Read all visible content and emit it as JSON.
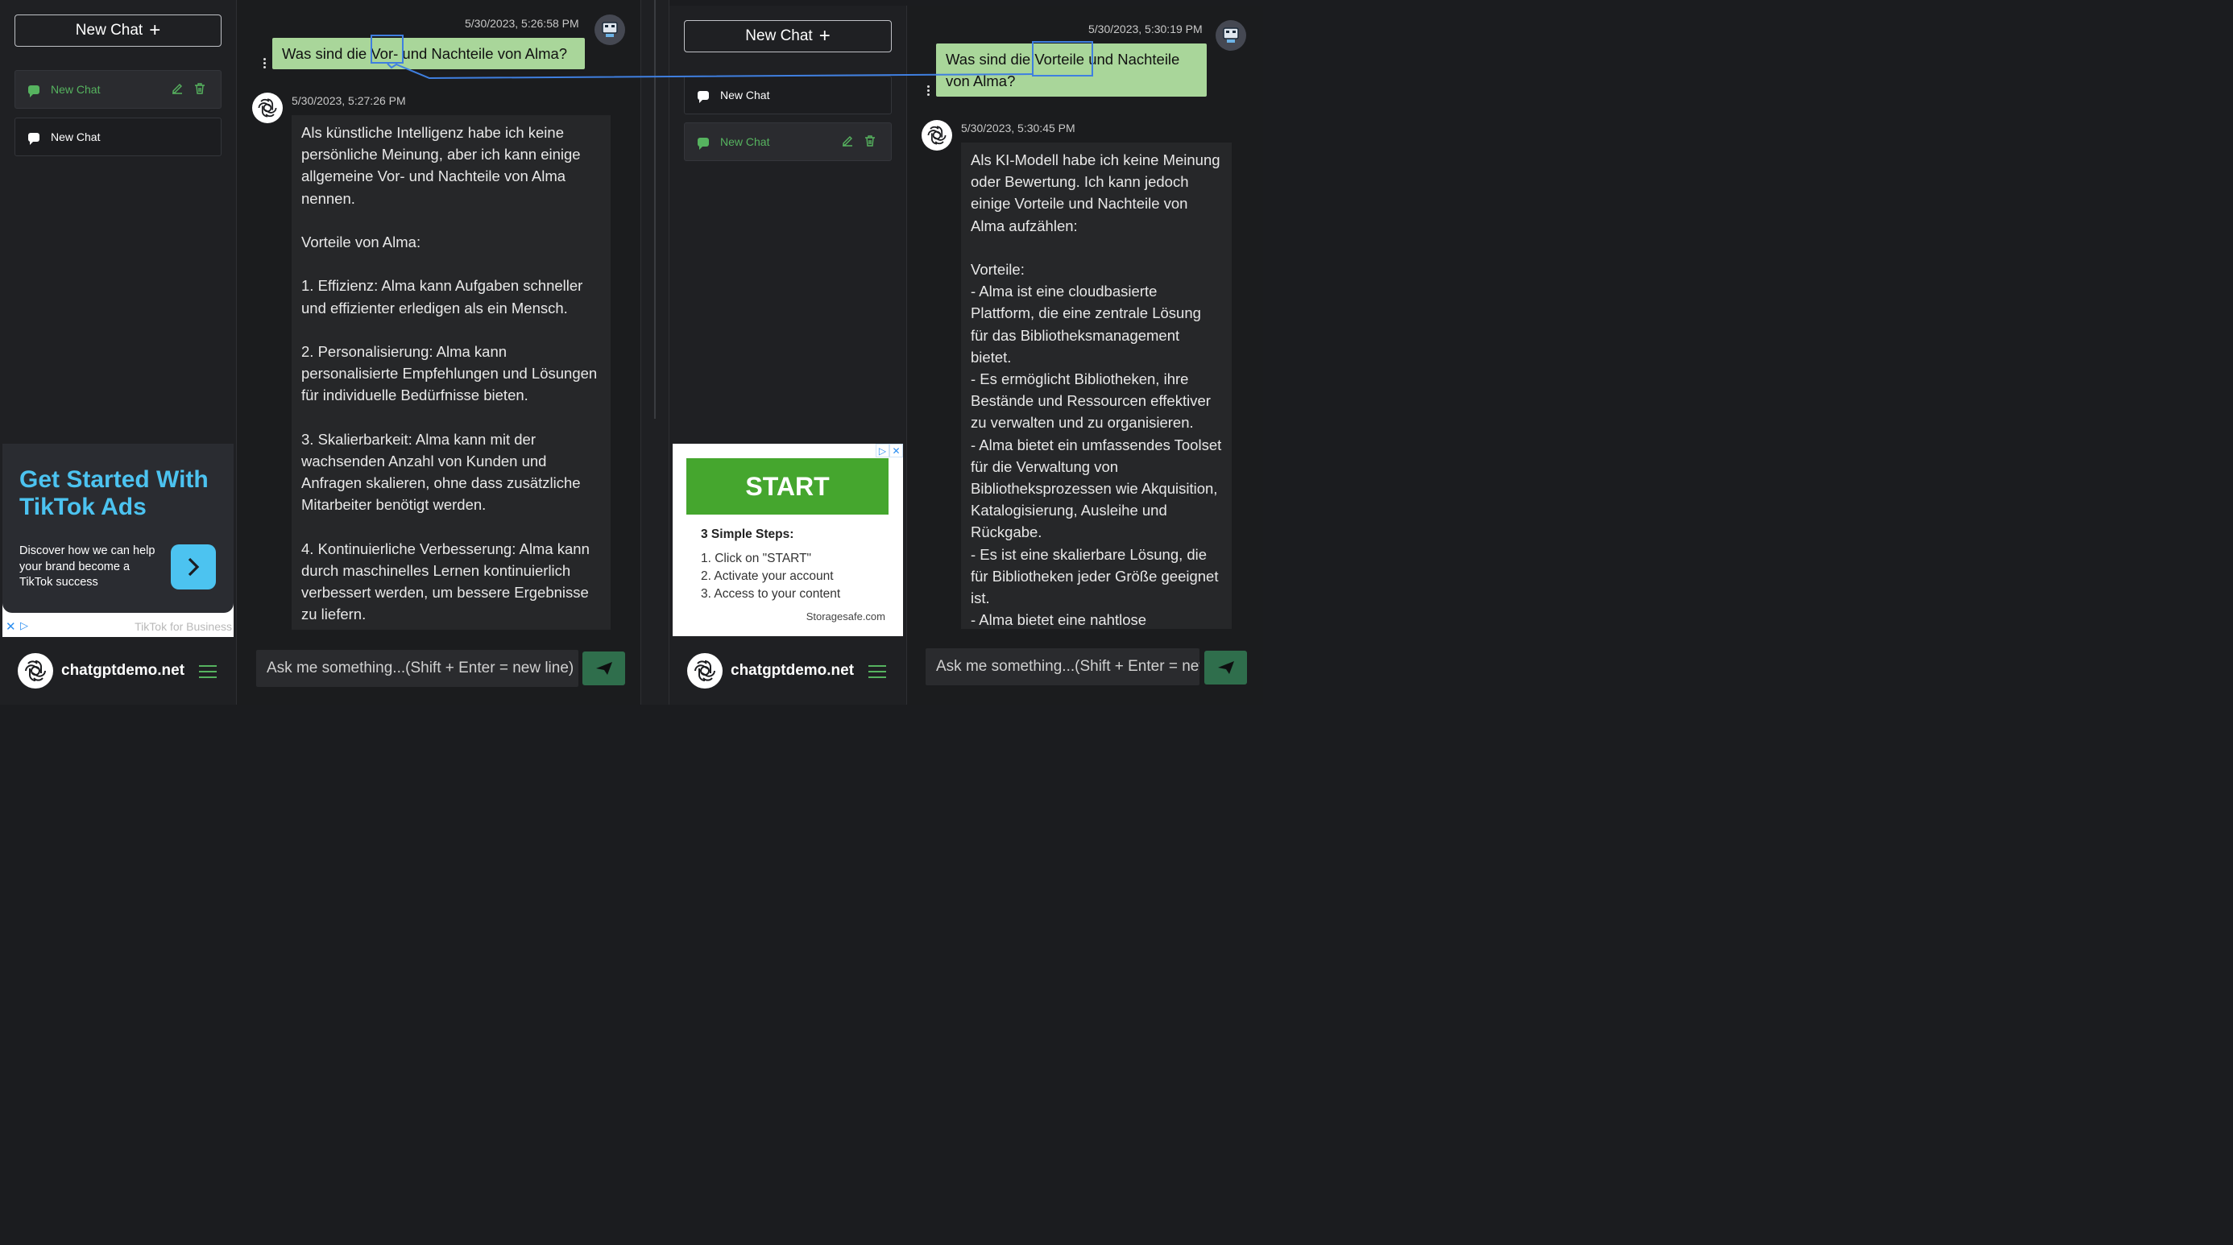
{
  "left": {
    "sidebar": {
      "new_chat_label": "New Chat",
      "chats": [
        {
          "label": "New Chat",
          "active": true
        },
        {
          "label": "New Chat",
          "active": false
        }
      ],
      "ad": {
        "title": "Get Started With TikTok Ads",
        "subtitle": "Discover how we can help your brand become a TikTok success",
        "footer": "TikTok for Business"
      },
      "brand": "chatgptdemo.net"
    },
    "conversation": {
      "user_time": "5/30/2023, 5:26:58 PM",
      "user_text": "Was sind die Vor- und Nachteile von Alma?",
      "bot_time": "5/30/2023, 5:27:26 PM",
      "bot_text": "Als künstliche Intelligenz habe ich keine persönliche Meinung, aber ich kann einige allgemeine Vor- und Nachteile von Alma nennen.\n\nVorteile von Alma:\n\n1. Effizienz: Alma kann Aufgaben schneller und effizienter erledigen als ein Mensch.\n\n2. Personalisierung: Alma kann personalisierte Empfehlungen und Lösungen für individuelle Bedürfnisse bieten.\n\n3. Skalierbarkeit: Alma kann mit der wachsenden Anzahl von Kunden und Anfragen skalieren, ohne dass zusätzliche Mitarbeiter benötigt werden.\n\n4. Kontinuierliche Verbesserung: Alma kann durch maschinelles Lernen kontinuierlich verbessert werden, um bessere Ergebnisse zu liefern."
    },
    "input_placeholder": "Ask me something...(Shift + Enter = new line)"
  },
  "right": {
    "sidebar": {
      "new_chat_label": "New Chat",
      "chats": [
        {
          "label": "New Chat",
          "active": false
        },
        {
          "label": "New Chat",
          "active": true
        }
      ],
      "ad": {
        "start_label": "START",
        "steps_title": "3 Simple Steps:",
        "steps": [
          "1. Click on \"START\"",
          "2. Activate your account",
          "3. Access to your content"
        ],
        "domain": "Storagesafe.com"
      },
      "brand": "chatgptdemo.net"
    },
    "conversation": {
      "user_time": "5/30/2023, 5:30:19 PM",
      "user_text": "Was sind die Vorteile und Nachteile von Alma?",
      "bot_time": "5/30/2023, 5:30:45 PM",
      "bot_text": "Als KI-Modell habe ich keine Meinung oder Bewertung. Ich kann jedoch einige Vorteile und Nachteile von Alma aufzählen:\n\nVorteile:\n- Alma ist eine cloudbasierte Plattform, die eine zentrale Lösung für das Bibliotheksmanagement bietet.\n- Es ermöglicht Bibliotheken, ihre Bestände und Ressourcen effektiver zu verwalten und zu organisieren.\n- Alma bietet ein umfassendes Toolset für die Verwaltung von Bibliotheksprozessen wie Akquisition, Katalogisierung, Ausleihe und Rückgabe.\n- Es ist eine skalierbare Lösung, die für Bibliotheken jeder Größe geeignet ist.\n- Alma bietet eine nahtlose"
    },
    "input_placeholder": "Ask me something...(Shift + Enter = new line)"
  },
  "colors": {
    "accent_green": "#56b35f",
    "user_bubble": "#a9d69a",
    "highlight": "#3f7fe0",
    "tiktok_blue": "#4cc3f0",
    "start_green": "#45a62e"
  },
  "icons": [
    "plus-icon",
    "chat-bubble-icon",
    "edit-icon",
    "trash-icon",
    "robot-avatar-icon",
    "openai-logo-icon",
    "menu-icon",
    "send-icon",
    "more-vertical-icon",
    "chevron-right-icon",
    "adchoices-icon",
    "close-icon"
  ]
}
